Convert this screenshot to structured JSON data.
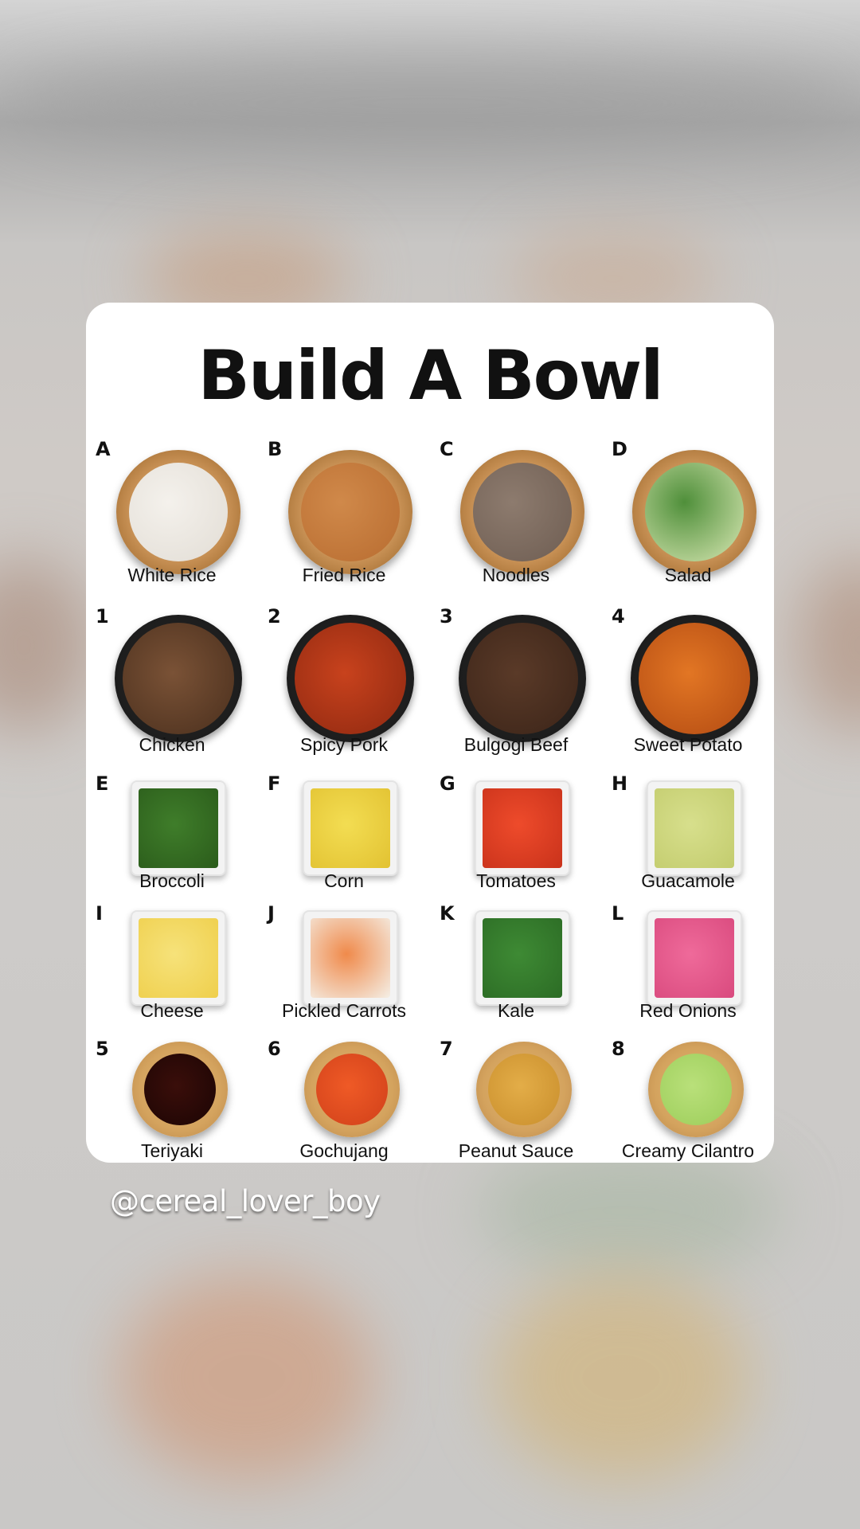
{
  "card": {
    "title": "Build A Bowl",
    "rows": [
      {
        "dish": "wood-bowl",
        "items": [
          {
            "badge": "A",
            "label": "White Rice",
            "icon": "white-rice-bowl-icon",
            "colors": [
              "#f4f1ec",
              "#e2ddd5"
            ]
          },
          {
            "badge": "B",
            "label": "Fried Rice",
            "icon": "fried-rice-bowl-icon",
            "colors": [
              "#d0894a",
              "#b86c30"
            ]
          },
          {
            "badge": "C",
            "label": "Noodles",
            "icon": "noodles-bowl-icon",
            "colors": [
              "#8d7b6e",
              "#6e5d52"
            ]
          },
          {
            "badge": "D",
            "label": "Salad",
            "icon": "salad-bowl-icon",
            "colors": [
              "#4f8f3a",
              "#d9e8b4"
            ]
          }
        ]
      },
      {
        "dish": "pan",
        "items": [
          {
            "badge": "1",
            "label": "Chicken",
            "icon": "chicken-pan-icon",
            "colors": [
              "#7a5236",
              "#4a2f1d"
            ]
          },
          {
            "badge": "2",
            "label": "Spicy Pork",
            "icon": "spicy-pork-pan-icon",
            "colors": [
              "#c8421d",
              "#8e2810"
            ]
          },
          {
            "badge": "3",
            "label": "Bulgogi Beef",
            "icon": "bulgogi-beef-pan-icon",
            "colors": [
              "#5a3a28",
              "#3b2418"
            ]
          },
          {
            "badge": "4",
            "label": "Sweet Potato",
            "icon": "sweet-potato-pan-icon",
            "colors": [
              "#e27624",
              "#b24a12"
            ]
          }
        ]
      },
      {
        "dish": "square-dish",
        "items": [
          {
            "badge": "E",
            "label": "Broccoli",
            "icon": "broccoli-dish-icon",
            "colors": [
              "#3f7d2a",
              "#2b5c1b"
            ]
          },
          {
            "badge": "F",
            "label": "Corn",
            "icon": "corn-dish-icon",
            "colors": [
              "#f3dd52",
              "#e2c232"
            ]
          },
          {
            "badge": "G",
            "label": "Tomatoes",
            "icon": "tomatoes-dish-icon",
            "colors": [
              "#ee4b2b",
              "#c9321b"
            ]
          },
          {
            "badge": "H",
            "label": "Guacamole",
            "icon": "guacamole-dish-icon",
            "colors": [
              "#d7df8c",
              "#c3cc6e"
            ]
          }
        ]
      },
      {
        "dish": "square-dish",
        "items": [
          {
            "badge": "I",
            "label": "Cheese",
            "icon": "cheese-dish-icon",
            "colors": [
              "#f6e27a",
              "#efcf4c"
            ]
          },
          {
            "badge": "J",
            "label": "Pickled Carrots",
            "icon": "pickled-carrots-dish-icon",
            "colors": [
              "#f08a4b",
              "#f4efe6"
            ]
          },
          {
            "badge": "K",
            "label": "Kale",
            "icon": "kale-dish-icon",
            "colors": [
              "#3e8a34",
              "#2c6c25"
            ]
          },
          {
            "badge": "L",
            "label": "Red Onions",
            "icon": "red-onions-dish-icon",
            "colors": [
              "#ef6a9a",
              "#d94a7e"
            ]
          }
        ]
      },
      {
        "dish": "sauce-bowl",
        "items": [
          {
            "badge": "5",
            "label": "Teriyaki",
            "icon": "teriyaki-sauce-icon",
            "colors": [
              "#3a0e0a",
              "#1b0504"
            ]
          },
          {
            "badge": "6",
            "label": "Gochujang",
            "icon": "gochujang-sauce-icon",
            "colors": [
              "#ef5a26",
              "#d0401a"
            ]
          },
          {
            "badge": "7",
            "label": "Peanut Sauce",
            "icon": "peanut-sauce-icon",
            "colors": [
              "#e3ad48",
              "#c98e2c"
            ]
          },
          {
            "badge": "8",
            "label": "Creamy Cilantro",
            "icon": "creamy-cilantro-sauce-icon",
            "colors": [
              "#b9e07a",
              "#9ccd5a"
            ]
          }
        ]
      }
    ]
  },
  "handle": "@cereal_lover_boy",
  "colors": {
    "card": "#ffffff",
    "text": "#111111",
    "handle": "#ffffff"
  }
}
